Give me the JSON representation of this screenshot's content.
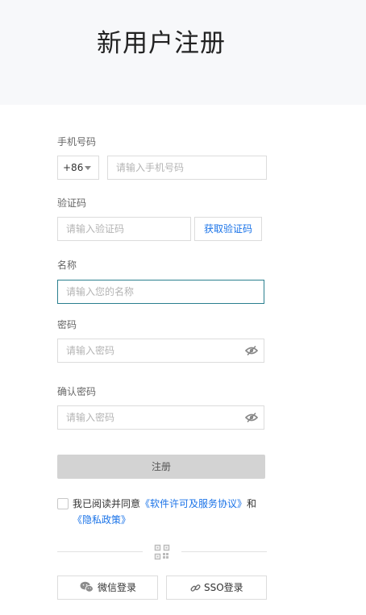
{
  "header": {
    "title": "新用户注册"
  },
  "form": {
    "phone": {
      "label": "手机号码",
      "country_code": "+86",
      "placeholder": "请输入手机号码"
    },
    "code": {
      "label": "验证码",
      "placeholder": "请输入验证码",
      "button": "获取验证码"
    },
    "name": {
      "label": "名称",
      "placeholder": "请输入您的名称"
    },
    "password": {
      "label": "密码",
      "placeholder": "请输入密码"
    },
    "confirm": {
      "label": "确认密码",
      "placeholder": "请输入密码"
    },
    "submit": "注册"
  },
  "agreement": {
    "prefix": "我已阅读并同意",
    "license_link": "《软件许可及服务协议》",
    "and": "和",
    "privacy_link": "《隐私政策》"
  },
  "alt_login": {
    "qr_icon": "qrcode-icon",
    "wechat": {
      "label": "微信登录",
      "icon": "wechat-icon"
    },
    "sso": {
      "label": "SSO登录",
      "icon": "link-icon"
    }
  },
  "colors": {
    "link": "#1a73e8",
    "focus_border": "#2a7f8f",
    "submit_bg": "#d3d3d3"
  }
}
